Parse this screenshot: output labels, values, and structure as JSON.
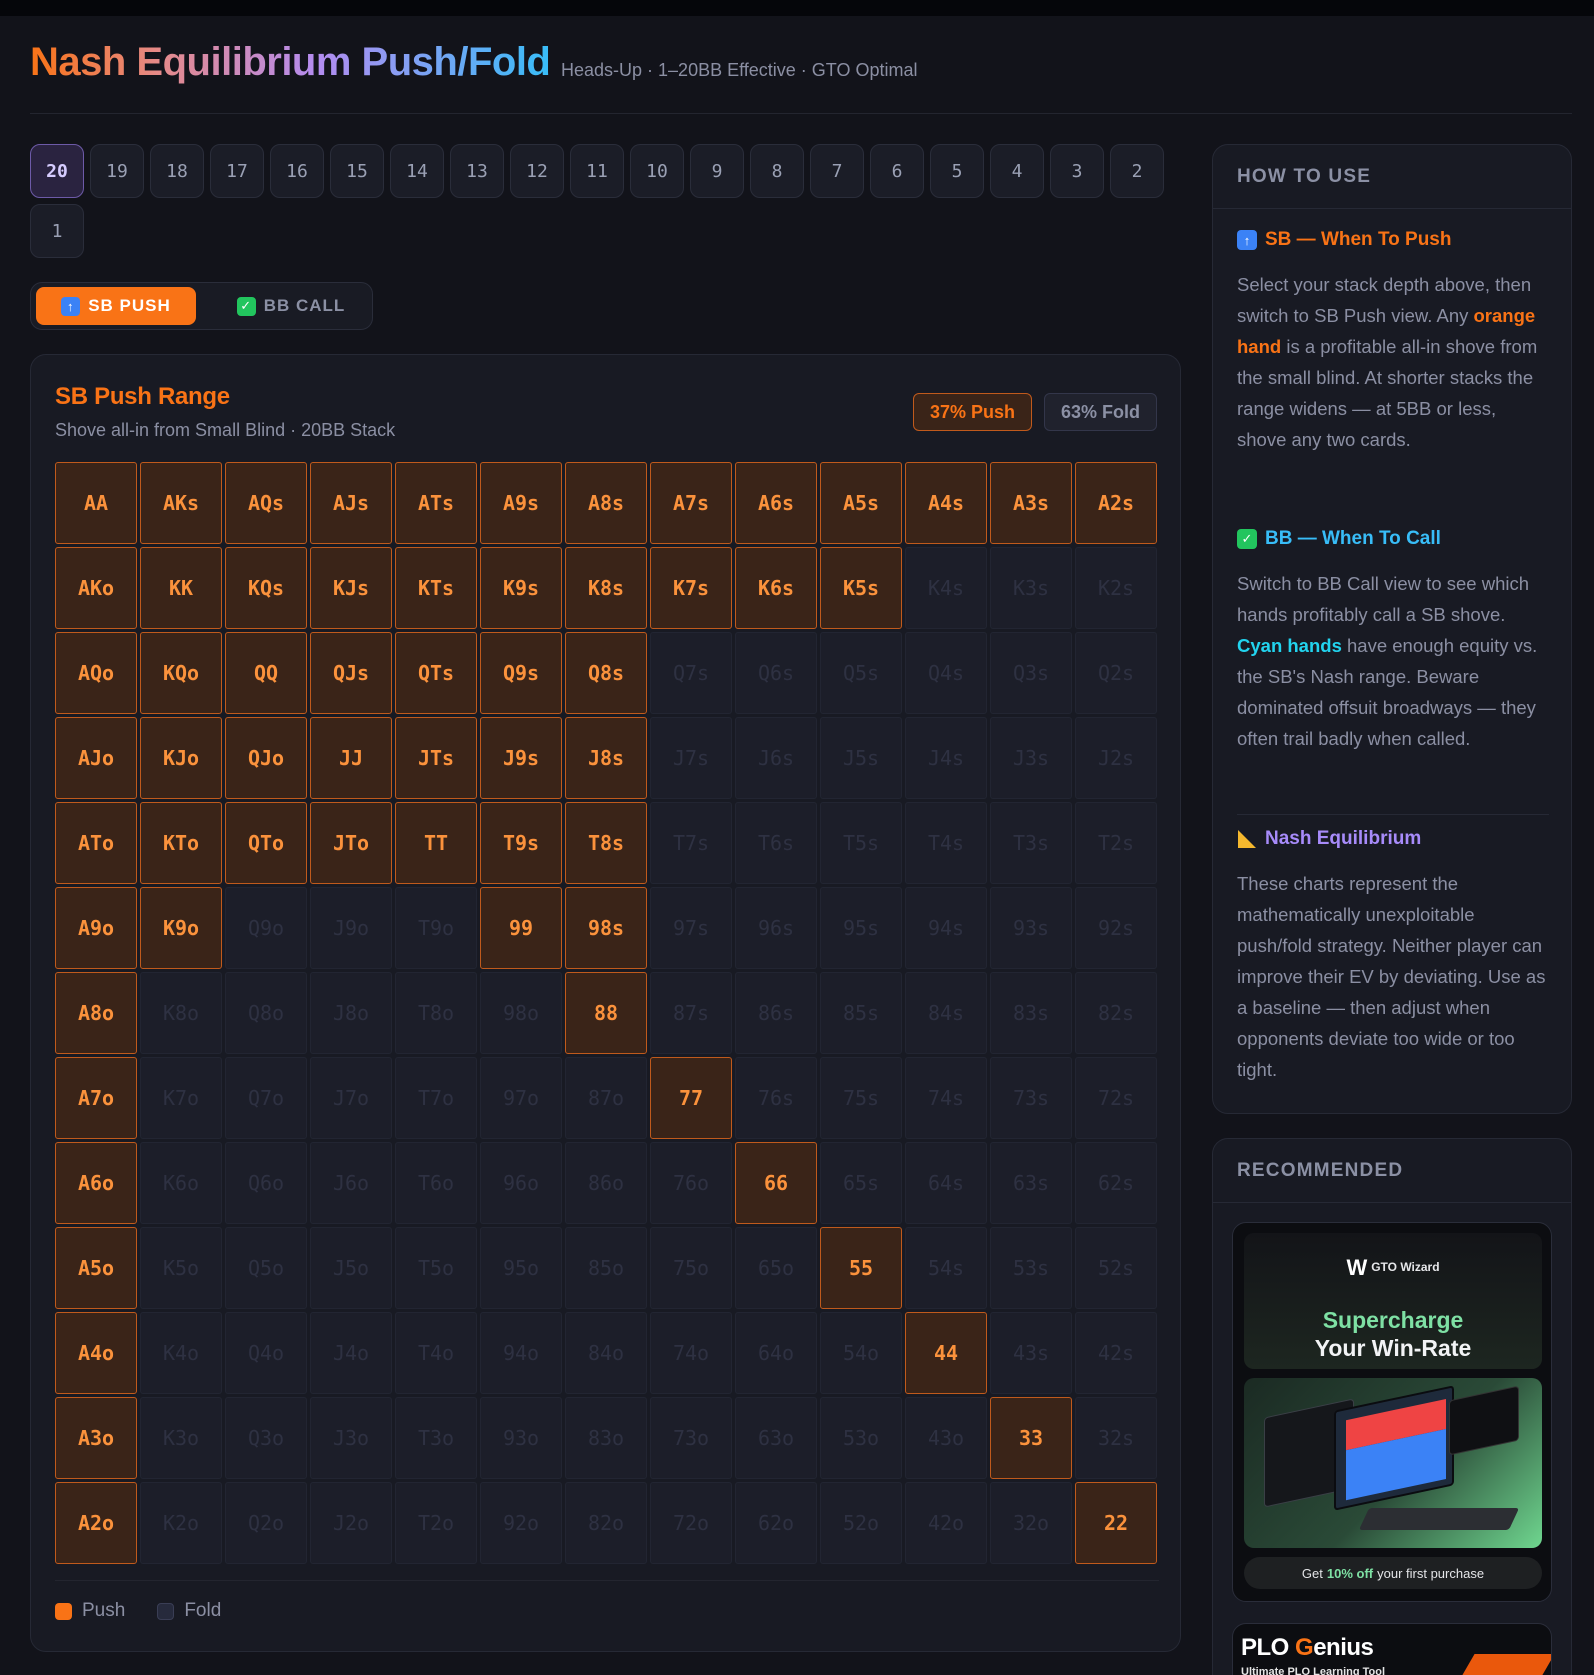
{
  "header": {
    "title": "Nash Equilibrium Push/Fold",
    "subtitle": "Heads-Up · 1–20BB Effective · GTO Optimal"
  },
  "stacks": {
    "active": "20",
    "items": [
      "20",
      "19",
      "18",
      "17",
      "16",
      "15",
      "14",
      "13",
      "12",
      "11",
      "10",
      "9",
      "8",
      "7",
      "6",
      "5",
      "4",
      "3",
      "2",
      "1"
    ]
  },
  "view_toggle": {
    "push_label": "SB PUSH",
    "call_label": "BB CALL",
    "active": "SB PUSH"
  },
  "range": {
    "title": "SB Push Range",
    "subtitle": "Shove all-in from Small Blind · 20BB Stack",
    "push_badge": "37% Push",
    "fold_badge": "63% Fold",
    "rows": [
      [
        "AA",
        "AKs",
        "AQs",
        "AJs",
        "ATs",
        "A9s",
        "A8s",
        "A7s",
        "A6s",
        "A5s",
        "A4s",
        "A3s",
        "A2s"
      ],
      [
        "AKo",
        "KK",
        "KQs",
        "KJs",
        "KTs",
        "K9s",
        "K8s",
        "K7s",
        "K6s",
        "K5s",
        "K4s",
        "K3s",
        "K2s"
      ],
      [
        "AQo",
        "KQo",
        "QQ",
        "QJs",
        "QTs",
        "Q9s",
        "Q8s",
        "Q7s",
        "Q6s",
        "Q5s",
        "Q4s",
        "Q3s",
        "Q2s"
      ],
      [
        "AJo",
        "KJo",
        "QJo",
        "JJ",
        "JTs",
        "J9s",
        "J8s",
        "J7s",
        "J6s",
        "J5s",
        "J4s",
        "J3s",
        "J2s"
      ],
      [
        "ATo",
        "KTo",
        "QTo",
        "JTo",
        "TT",
        "T9s",
        "T8s",
        "T7s",
        "T6s",
        "T5s",
        "T4s",
        "T3s",
        "T2s"
      ],
      [
        "A9o",
        "K9o",
        "Q9o",
        "J9o",
        "T9o",
        "99",
        "98s",
        "97s",
        "96s",
        "95s",
        "94s",
        "93s",
        "92s"
      ],
      [
        "A8o",
        "K8o",
        "Q8o",
        "J8o",
        "T8o",
        "98o",
        "88",
        "87s",
        "86s",
        "85s",
        "84s",
        "83s",
        "82s"
      ],
      [
        "A7o",
        "K7o",
        "Q7o",
        "J7o",
        "T7o",
        "97o",
        "87o",
        "77",
        "76s",
        "75s",
        "74s",
        "73s",
        "72s"
      ],
      [
        "A6o",
        "K6o",
        "Q6o",
        "J6o",
        "T6o",
        "96o",
        "86o",
        "76o",
        "66",
        "65s",
        "64s",
        "63s",
        "62s"
      ],
      [
        "A5o",
        "K5o",
        "Q5o",
        "J5o",
        "T5o",
        "95o",
        "85o",
        "75o",
        "65o",
        "55",
        "54s",
        "53s",
        "52s"
      ],
      [
        "A4o",
        "K4o",
        "Q4o",
        "J4o",
        "T4o",
        "94o",
        "84o",
        "74o",
        "64o",
        "54o",
        "44",
        "43s",
        "42s"
      ],
      [
        "A3o",
        "K3o",
        "Q3o",
        "J3o",
        "T3o",
        "93o",
        "83o",
        "73o",
        "63o",
        "53o",
        "43o",
        "33",
        "32s"
      ],
      [
        "A2o",
        "K2o",
        "Q2o",
        "J2o",
        "T2o",
        "92o",
        "82o",
        "72o",
        "62o",
        "52o",
        "42o",
        "32o",
        "22"
      ]
    ],
    "push_hands": [
      "AA",
      "AKs",
      "AQs",
      "AJs",
      "ATs",
      "A9s",
      "A8s",
      "A7s",
      "A6s",
      "A5s",
      "A4s",
      "A3s",
      "A2s",
      "AKo",
      "KK",
      "KQs",
      "KJs",
      "KTs",
      "K9s",
      "K8s",
      "K7s",
      "K6s",
      "K5s",
      "AQo",
      "KQo",
      "QQ",
      "QJs",
      "QTs",
      "Q9s",
      "Q8s",
      "AJo",
      "KJo",
      "QJo",
      "JJ",
      "JTs",
      "J9s",
      "J8s",
      "ATo",
      "KTo",
      "QTo",
      "JTo",
      "TT",
      "T9s",
      "T8s",
      "A9o",
      "K9o",
      "99",
      "98s",
      "A8o",
      "88",
      "A7o",
      "77",
      "A6o",
      "66",
      "A5o",
      "55",
      "A4o",
      "44",
      "A3o",
      "33",
      "A2o",
      "22"
    ],
    "legend": {
      "push": "Push",
      "fold": "Fold"
    }
  },
  "how_to_use": {
    "heading": "HOW TO USE",
    "sb": {
      "title": "SB — When To Push",
      "text_1": "Select your stack depth above, then switch to SB Push view. Any ",
      "highlight": "orange hand",
      "text_2": " is a profitable all-in shove from the small blind. At shorter stacks the range widens — at 5BB or less, shove any two cards."
    },
    "bb": {
      "title": "BB — When To Call",
      "text_1": "Switch to BB Call view to see which hands profitably call a SB shove. ",
      "highlight": "Cyan hands",
      "text_2": " have enough equity vs. the SB's Nash range. Beware dominated offsuit broadways — they often trail badly when called."
    },
    "nash": {
      "title": "Nash Equilibrium",
      "text": "These charts represent the mathematically unexploitable push/fold strategy. Neither player can improve their EV by deviating. Use as a baseline — then adjust when opponents deviate too wide or too tight."
    }
  },
  "recommended": {
    "heading": "RECOMMENDED",
    "ad1": {
      "brand_mark": "W",
      "brand": "GTO Wizard",
      "headline_1": "Supercharge",
      "headline_2": "Your Win-Rate",
      "cta_1": "Get",
      "cta_hl": "10% off",
      "cta_2": "your first purchase"
    },
    "ad2": {
      "logo_1": "PLO ",
      "logo_g": "G",
      "logo_2": "enius",
      "tagline": "Ultimate PLO Learning Tool"
    }
  },
  "colors": {
    "push": "#f97316",
    "call": "#22d3ee",
    "nash": "#a78bfa",
    "background": "#12131a",
    "card": "#181a23"
  }
}
